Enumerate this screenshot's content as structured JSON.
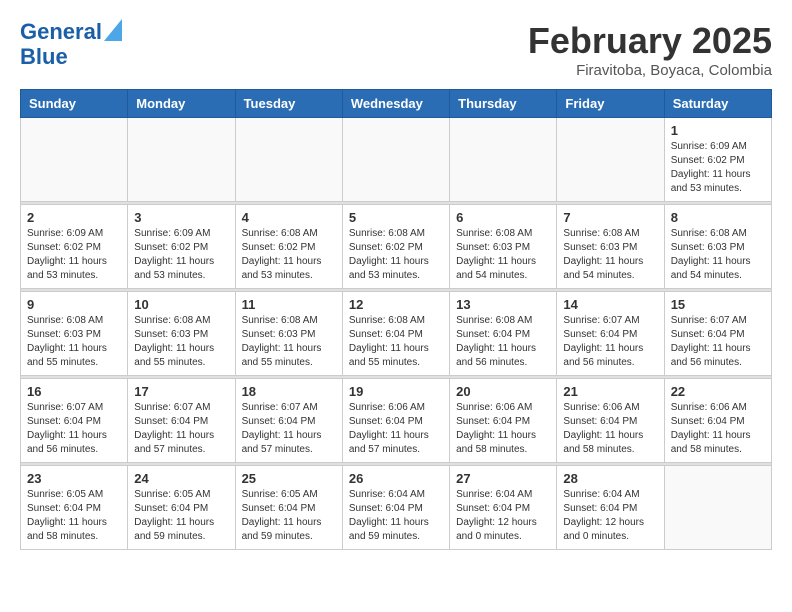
{
  "header": {
    "logo_line1": "General",
    "logo_line2": "Blue",
    "month": "February 2025",
    "location": "Firavitoba, Boyaca, Colombia"
  },
  "weekdays": [
    "Sunday",
    "Monday",
    "Tuesday",
    "Wednesday",
    "Thursday",
    "Friday",
    "Saturday"
  ],
  "weeks": [
    [
      {
        "day": "",
        "info": ""
      },
      {
        "day": "",
        "info": ""
      },
      {
        "day": "",
        "info": ""
      },
      {
        "day": "",
        "info": ""
      },
      {
        "day": "",
        "info": ""
      },
      {
        "day": "",
        "info": ""
      },
      {
        "day": "1",
        "info": "Sunrise: 6:09 AM\nSunset: 6:02 PM\nDaylight: 11 hours\nand 53 minutes."
      }
    ],
    [
      {
        "day": "2",
        "info": "Sunrise: 6:09 AM\nSunset: 6:02 PM\nDaylight: 11 hours\nand 53 minutes."
      },
      {
        "day": "3",
        "info": "Sunrise: 6:09 AM\nSunset: 6:02 PM\nDaylight: 11 hours\nand 53 minutes."
      },
      {
        "day": "4",
        "info": "Sunrise: 6:08 AM\nSunset: 6:02 PM\nDaylight: 11 hours\nand 53 minutes."
      },
      {
        "day": "5",
        "info": "Sunrise: 6:08 AM\nSunset: 6:02 PM\nDaylight: 11 hours\nand 53 minutes."
      },
      {
        "day": "6",
        "info": "Sunrise: 6:08 AM\nSunset: 6:03 PM\nDaylight: 11 hours\nand 54 minutes."
      },
      {
        "day": "7",
        "info": "Sunrise: 6:08 AM\nSunset: 6:03 PM\nDaylight: 11 hours\nand 54 minutes."
      },
      {
        "day": "8",
        "info": "Sunrise: 6:08 AM\nSunset: 6:03 PM\nDaylight: 11 hours\nand 54 minutes."
      }
    ],
    [
      {
        "day": "9",
        "info": "Sunrise: 6:08 AM\nSunset: 6:03 PM\nDaylight: 11 hours\nand 55 minutes."
      },
      {
        "day": "10",
        "info": "Sunrise: 6:08 AM\nSunset: 6:03 PM\nDaylight: 11 hours\nand 55 minutes."
      },
      {
        "day": "11",
        "info": "Sunrise: 6:08 AM\nSunset: 6:03 PM\nDaylight: 11 hours\nand 55 minutes."
      },
      {
        "day": "12",
        "info": "Sunrise: 6:08 AM\nSunset: 6:04 PM\nDaylight: 11 hours\nand 55 minutes."
      },
      {
        "day": "13",
        "info": "Sunrise: 6:08 AM\nSunset: 6:04 PM\nDaylight: 11 hours\nand 56 minutes."
      },
      {
        "day": "14",
        "info": "Sunrise: 6:07 AM\nSunset: 6:04 PM\nDaylight: 11 hours\nand 56 minutes."
      },
      {
        "day": "15",
        "info": "Sunrise: 6:07 AM\nSunset: 6:04 PM\nDaylight: 11 hours\nand 56 minutes."
      }
    ],
    [
      {
        "day": "16",
        "info": "Sunrise: 6:07 AM\nSunset: 6:04 PM\nDaylight: 11 hours\nand 56 minutes."
      },
      {
        "day": "17",
        "info": "Sunrise: 6:07 AM\nSunset: 6:04 PM\nDaylight: 11 hours\nand 57 minutes."
      },
      {
        "day": "18",
        "info": "Sunrise: 6:07 AM\nSunset: 6:04 PM\nDaylight: 11 hours\nand 57 minutes."
      },
      {
        "day": "19",
        "info": "Sunrise: 6:06 AM\nSunset: 6:04 PM\nDaylight: 11 hours\nand 57 minutes."
      },
      {
        "day": "20",
        "info": "Sunrise: 6:06 AM\nSunset: 6:04 PM\nDaylight: 11 hours\nand 58 minutes."
      },
      {
        "day": "21",
        "info": "Sunrise: 6:06 AM\nSunset: 6:04 PM\nDaylight: 11 hours\nand 58 minutes."
      },
      {
        "day": "22",
        "info": "Sunrise: 6:06 AM\nSunset: 6:04 PM\nDaylight: 11 hours\nand 58 minutes."
      }
    ],
    [
      {
        "day": "23",
        "info": "Sunrise: 6:05 AM\nSunset: 6:04 PM\nDaylight: 11 hours\nand 58 minutes."
      },
      {
        "day": "24",
        "info": "Sunrise: 6:05 AM\nSunset: 6:04 PM\nDaylight: 11 hours\nand 59 minutes."
      },
      {
        "day": "25",
        "info": "Sunrise: 6:05 AM\nSunset: 6:04 PM\nDaylight: 11 hours\nand 59 minutes."
      },
      {
        "day": "26",
        "info": "Sunrise: 6:04 AM\nSunset: 6:04 PM\nDaylight: 11 hours\nand 59 minutes."
      },
      {
        "day": "27",
        "info": "Sunrise: 6:04 AM\nSunset: 6:04 PM\nDaylight: 12 hours\nand 0 minutes."
      },
      {
        "day": "28",
        "info": "Sunrise: 6:04 AM\nSunset: 6:04 PM\nDaylight: 12 hours\nand 0 minutes."
      },
      {
        "day": "",
        "info": ""
      }
    ]
  ]
}
